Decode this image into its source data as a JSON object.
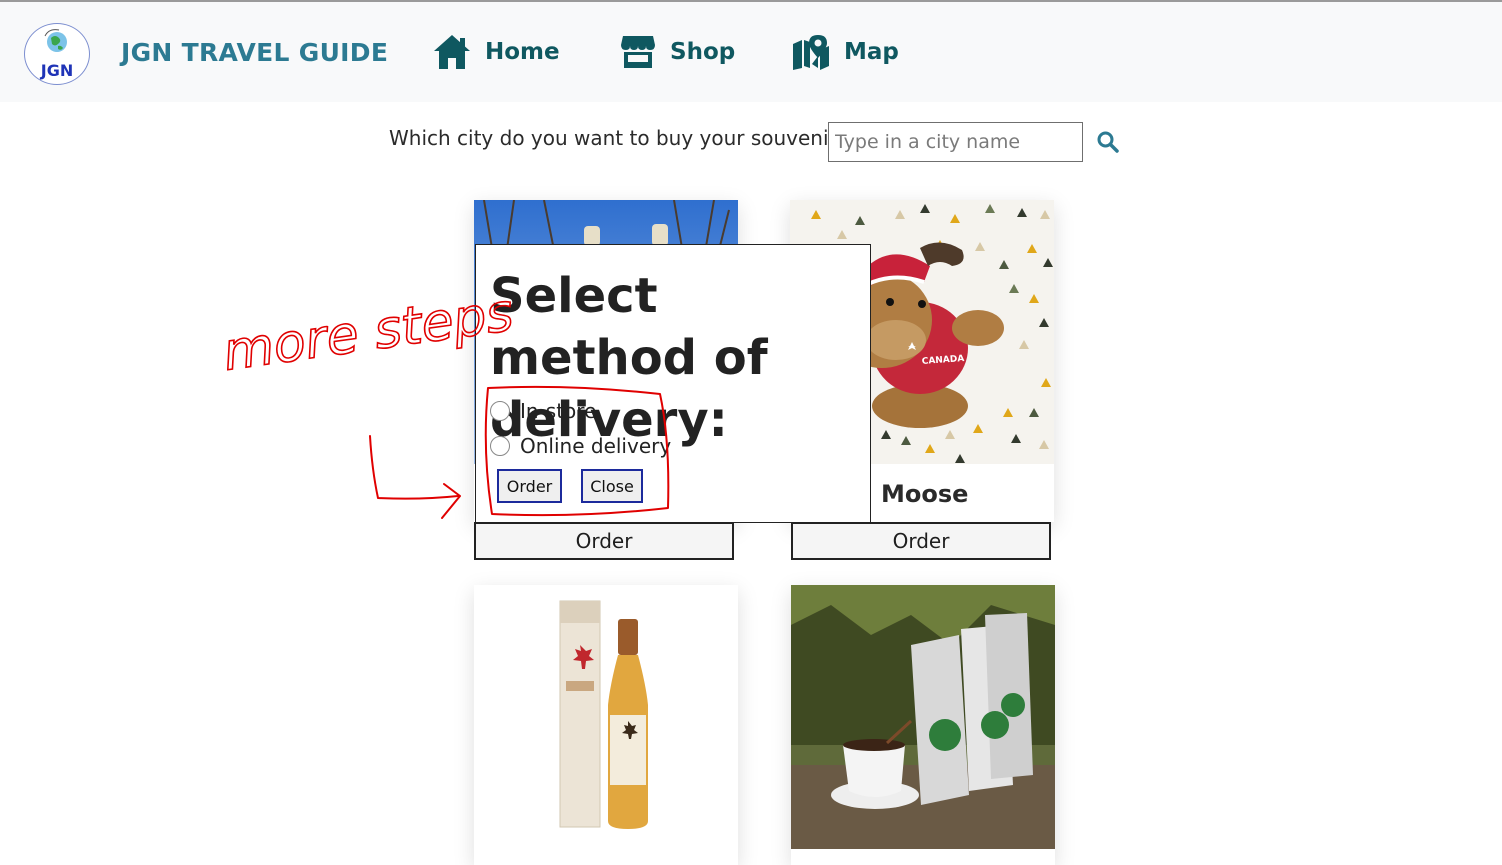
{
  "brand": {
    "logo_text": "JGN",
    "name": "JGN TRAVEL GUIDE"
  },
  "nav": {
    "items": [
      {
        "label": "Home",
        "icon": "home-icon"
      },
      {
        "label": "Shop",
        "icon": "store-icon"
      },
      {
        "label": "Map",
        "icon": "map-marker-icon"
      }
    ]
  },
  "search": {
    "question": "Which city do you want to buy your souvenir?",
    "placeholder": "Type in a city name",
    "value": "",
    "icon": "search-icon"
  },
  "products": [
    {
      "name": "",
      "order_label": "Order",
      "image": "icewine-bottles-photo"
    },
    {
      "name": "Moose",
      "order_label": "Order",
      "image": "moose-plush-photo"
    },
    {
      "name": "",
      "order_label": "",
      "image": "maplewine-bottle-photo"
    },
    {
      "name": "",
      "order_label": "",
      "image": "coffee-bags-photo"
    }
  ],
  "modal": {
    "title": "Select method of delivery:",
    "options": [
      "In-store",
      "Online delivery"
    ],
    "order_label": "Order",
    "close_label": "Close"
  },
  "annotation": {
    "text": "more steps"
  },
  "colors": {
    "brand": "#2c7a92",
    "nav_text": "#0f5860",
    "search_icon": "#2c7a92",
    "annotation": "#e00000",
    "modal_button_border": "#1c2a9c"
  }
}
